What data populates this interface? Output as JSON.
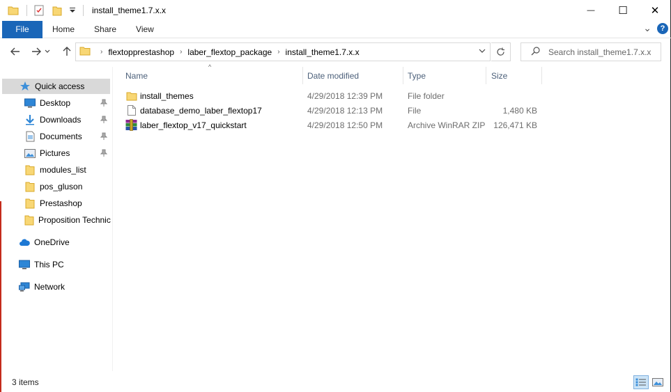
{
  "window": {
    "title": "install_theme1.7.x.x",
    "controls": {
      "minimize": "—",
      "maximize": "☐",
      "close": "✕"
    }
  },
  "ribbon": {
    "tabs": [
      "File",
      "Home",
      "Share",
      "View"
    ],
    "expand_glyph": "⌄",
    "help_glyph": "?"
  },
  "navigation": {
    "breadcrumb": [
      "flextopprestashop",
      "laber_flextop_package",
      "install_theme1.7.x.x"
    ],
    "search_placeholder": "Search install_theme1.7.x.x"
  },
  "sidebar": {
    "items": [
      {
        "label": "Quick access",
        "icon": "star-icon",
        "active": true
      },
      {
        "label": "Desktop",
        "icon": "desktop-icon",
        "pinned": true
      },
      {
        "label": "Downloads",
        "icon": "download-icon",
        "pinned": true
      },
      {
        "label": "Documents",
        "icon": "document-icon",
        "pinned": true
      },
      {
        "label": "Pictures",
        "icon": "pictures-icon",
        "pinned": true
      },
      {
        "label": "modules_list",
        "icon": "folder-icon"
      },
      {
        "label": "pos_gluson",
        "icon": "folder-icon"
      },
      {
        "label": "Prestashop",
        "icon": "folder-icon"
      },
      {
        "label": "Proposition Technic",
        "icon": "folder-icon"
      },
      {
        "label": "OneDrive",
        "icon": "cloud-icon"
      },
      {
        "label": "This PC",
        "icon": "computer-icon"
      },
      {
        "label": "Network",
        "icon": "network-icon"
      }
    ]
  },
  "columns": {
    "name": "Name",
    "date": "Date modified",
    "type": "Type",
    "size": "Size"
  },
  "files": [
    {
      "name": "install_themes",
      "date": "4/29/2018 12:39 PM",
      "type": "File folder",
      "size": "",
      "icon": "folder-icon"
    },
    {
      "name": "database_demo_laber_flextop17",
      "date": "4/29/2018 12:13 PM",
      "type": "File",
      "size": "1,480 KB",
      "icon": "file-icon"
    },
    {
      "name": "laber_flextop_v17_quickstart",
      "date": "4/29/2018 12:50 PM",
      "type": "Archive WinRAR ZIP",
      "size": "126,471 KB",
      "icon": "winrar-icon"
    }
  ],
  "status": {
    "item_count": "3 items"
  },
  "colors": {
    "accent": "#1a66b8",
    "folder": "#f8d775",
    "selection": "#d9d9d9"
  }
}
